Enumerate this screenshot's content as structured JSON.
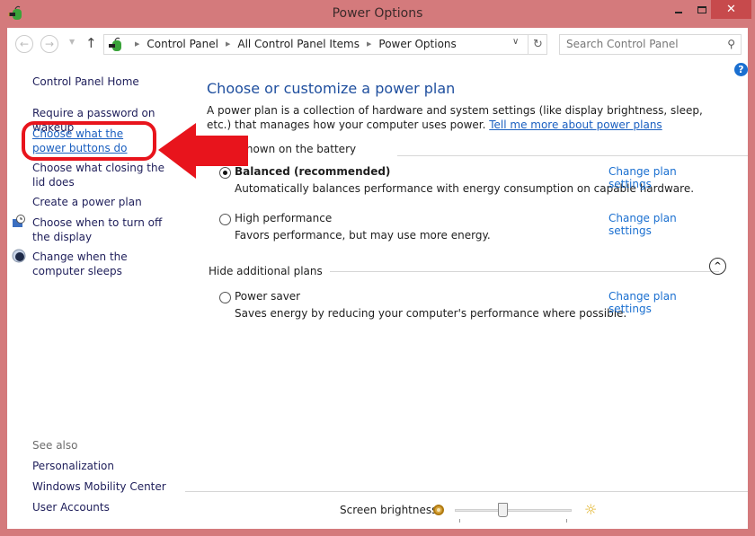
{
  "window": {
    "title": "Power Options",
    "minimize_icon": "minimize-icon",
    "maximize_icon": "maximize-icon",
    "close_icon": "close-icon",
    "close_glyph": "✕"
  },
  "navbar": {
    "back_glyph": "←",
    "forward_glyph": "→",
    "recent_glyph": "▼",
    "up_glyph": "↑",
    "breadcrumb": [
      "Control Panel",
      "All Control Panel Items",
      "Power Options"
    ],
    "crumb_sep": "▶",
    "dropdown_glyph": "∨",
    "refresh_glyph": "↻",
    "search_placeholder": "Search Control Panel",
    "search_glyph": "⚲"
  },
  "help_glyph": "?",
  "sidebar": {
    "home": "Control Panel Home",
    "links": [
      {
        "label": "Require a password on wakeup",
        "highlighted": false
      },
      {
        "label": "Choose what the power buttons do",
        "highlighted": true
      },
      {
        "label": "Choose what closing the lid does",
        "highlighted": false
      },
      {
        "label": "Create a power plan",
        "highlighted": false
      },
      {
        "label": "Choose when to turn off the display",
        "icon": "display-clock-icon",
        "highlighted": false
      },
      {
        "label": "Change when the computer sleeps",
        "icon": "moon-sleep-icon",
        "highlighted": false
      }
    ],
    "see_also_label": "See also",
    "see_also": [
      "Personalization",
      "Windows Mobility Center",
      "User Accounts"
    ]
  },
  "main": {
    "heading": "Choose or customize a power plan",
    "intro": "A power plan is a collection of hardware and system settings (like display brightness, sleep, etc.) that manages how your computer uses power. ",
    "intro_link": "Tell me more about power plans",
    "group1_label": "Plans shown on the battery meter",
    "group2_label": "Hide additional plans",
    "collapse_glyph": "^",
    "change_link": "Change plan settings",
    "plans": [
      {
        "name": "Balanced (recommended)",
        "description": "Automatically balances performance with energy consumption on capable hardware.",
        "selected": true
      },
      {
        "name": "High performance",
        "description": "Favors performance, but may use more energy.",
        "selected": false
      },
      {
        "name": "Power saver",
        "description": "Saves energy by reducing your computer's performance where possible.",
        "selected": false
      }
    ]
  },
  "footer": {
    "brightness_label": "Screen brightness:",
    "brightness_value_percent": 40,
    "high_glyph": "☼"
  },
  "annotation": {
    "color": "#e8141c",
    "target": "Choose what the power buttons do"
  }
}
